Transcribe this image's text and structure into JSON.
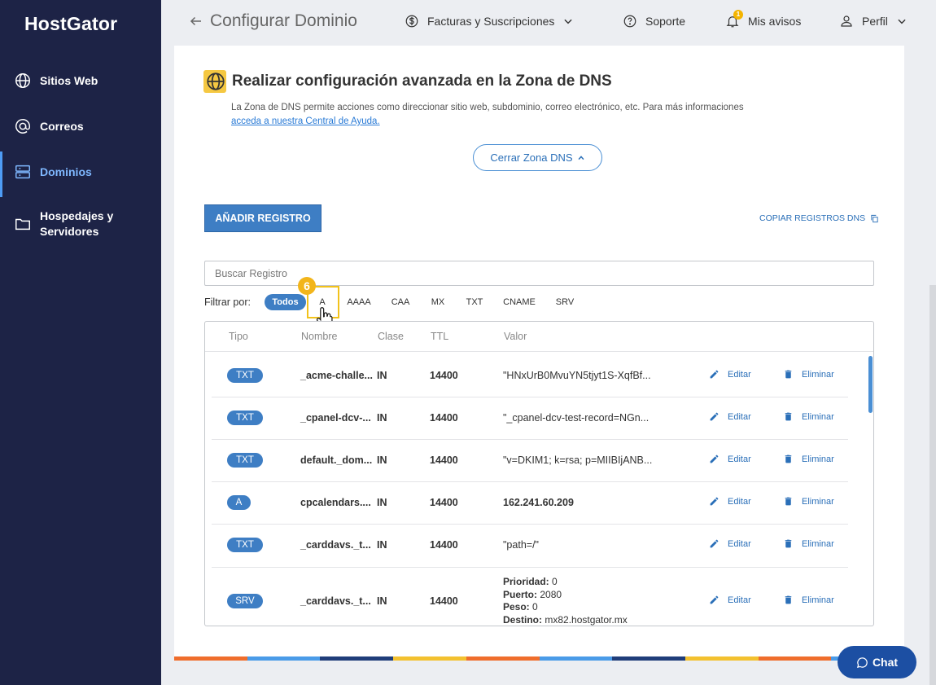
{
  "sidebar": {
    "logo": "HostGator",
    "items": [
      {
        "label": "Sitios Web"
      },
      {
        "label": "Correos"
      },
      {
        "label": "Dominios"
      },
      {
        "label": "Hospedajes y Servidores"
      }
    ]
  },
  "header": {
    "title": "Configurar Dominio",
    "billing": "Facturas y Suscripciones",
    "support": "Soporte",
    "notifications": "Mis avisos",
    "notification_count": "1",
    "profile": "Perfil"
  },
  "dns": {
    "title": "Realizar configuración avanzada en la Zona de DNS",
    "description": "La Zona de DNS permite acciones como direccionar sitio web, subdominio, correo electrónico, etc. Para más informaciones",
    "help_link": "acceda a nuestra Central de Ayuda.",
    "close_zone": "Cerrar Zona DNS",
    "add_record": "AÑADIR REGISTRO",
    "copy_records": "COPIAR REGISTROS DNS",
    "search_placeholder": "Buscar Registro",
    "filter_label": "Filtrar por:",
    "filters": [
      "Todos",
      "A",
      "AAAA",
      "CAA",
      "MX",
      "TXT",
      "CNAME",
      "SRV"
    ],
    "step_number": "6"
  },
  "table": {
    "headers": [
      "Tipo",
      "Nombre",
      "Clase",
      "TTL",
      "Valor"
    ],
    "edit_label": "Editar",
    "delete_label": "Eliminar",
    "rows": [
      {
        "type": "TXT",
        "name": "_acme-challe...",
        "class": "IN",
        "ttl": "14400",
        "value": "\"HNxUrB0MvuYN5tjyt1S-XqfBf..."
      },
      {
        "type": "TXT",
        "name": "_cpanel-dcv-...",
        "class": "IN",
        "ttl": "14400",
        "value": "\"_cpanel-dcv-test-record=NGn..."
      },
      {
        "type": "TXT",
        "name": "default._dom...",
        "class": "IN",
        "ttl": "14400",
        "value": "\"v=DKIM1; k=rsa; p=MIIBIjANB..."
      },
      {
        "type": "A",
        "name": "cpcalendars....",
        "class": "IN",
        "ttl": "14400",
        "value": "162.241.60.209"
      },
      {
        "type": "TXT",
        "name": "_carddavs._t...",
        "class": "IN",
        "ttl": "14400",
        "value": "\"path=/\""
      },
      {
        "type": "SRV",
        "name": "_carddavs._t...",
        "class": "IN",
        "ttl": "14400",
        "srv": {
          "priority_label": "Prioridad:",
          "priority": "0",
          "port_label": "Puerto:",
          "port": "2080",
          "weight_label": "Peso:",
          "weight": "0",
          "target_label": "Destino:",
          "target": "mx82.hostgator.mx"
        }
      }
    ]
  },
  "chat": {
    "label": "Chat"
  },
  "colors": {
    "sidebar": "#1d2346",
    "accent": "#3e7ec4",
    "highlight": "#f2c21b"
  }
}
